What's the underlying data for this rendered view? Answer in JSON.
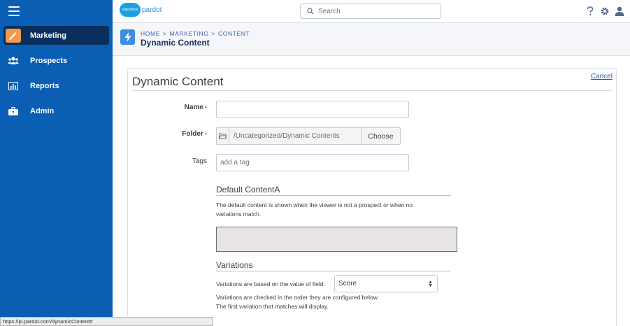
{
  "sidebar": {
    "items": [
      {
        "label": "Marketing",
        "icon": "wand-icon",
        "active": true
      },
      {
        "label": "Prospects",
        "icon": "people-icon",
        "active": false
      },
      {
        "label": "Reports",
        "icon": "bar-chart-icon",
        "active": false
      },
      {
        "label": "Admin",
        "icon": "briefcase-icon",
        "active": false
      }
    ]
  },
  "header": {
    "logo_salesforce": "salesforce",
    "logo_product": "pardot",
    "search_placeholder": "Search"
  },
  "page": {
    "breadcrumb": [
      "HOME",
      "MARKETING",
      "CONTENT"
    ],
    "title": "Dynamic Content"
  },
  "form": {
    "heading": "Dynamic Content",
    "cancel_label": "Cancel",
    "name_label": "Name",
    "name_value": "",
    "folder_label": "Folder",
    "folder_path": "/Uncategorized/Dynamic Contents",
    "choose_label": "Choose",
    "tags_label": "Tags",
    "tags_placeholder": "add a tag",
    "default_heading": "Default ContentA",
    "default_desc_line1": "The default content is shown when the viewer is not a prospect or when no",
    "default_desc_line2": "variations match.",
    "variations_heading": "Variations",
    "variations_field_label": "Variations are based on the value of field:",
    "variations_field_value": "Score",
    "variations_note_line1": "Variations are checked in the order they are configured below.",
    "variations_note_line2": "The first variation that matches will display."
  },
  "status_bar": {
    "url": "https://pi.pardot.com/dynamicContent#"
  },
  "colors": {
    "sidebar_bg": "#0a5fb4",
    "sidebar_active": "#0a2f5c",
    "accent_orange": "#f49a4c",
    "link_blue": "#1c5fac",
    "required": "#e26e2e"
  }
}
